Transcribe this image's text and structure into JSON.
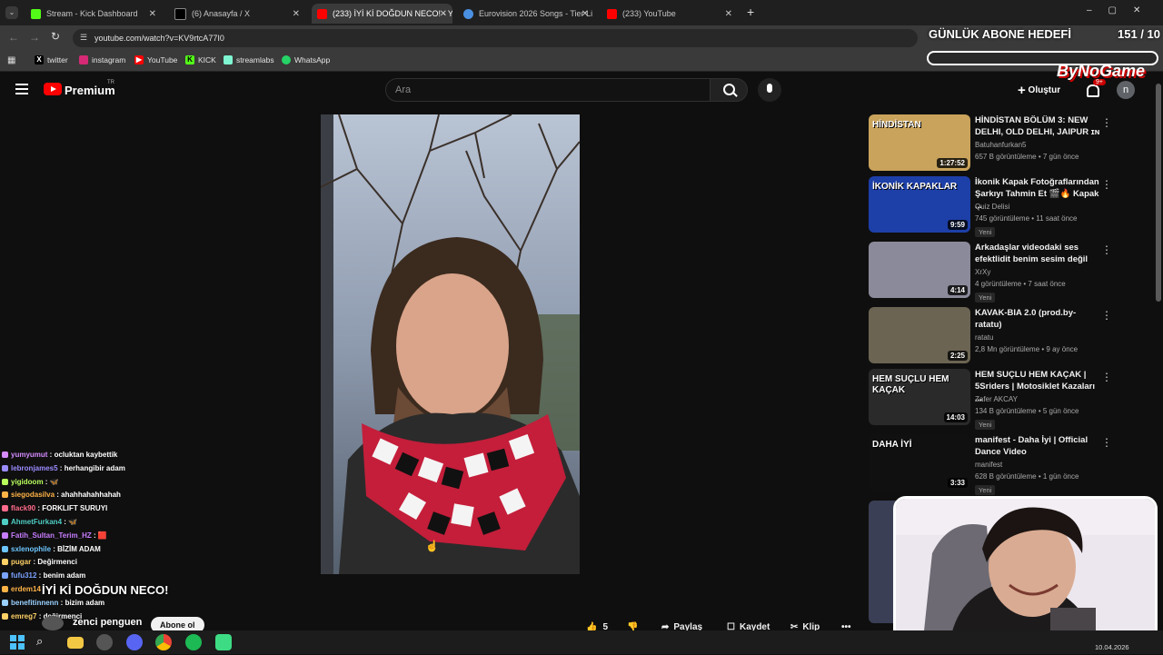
{
  "browser": {
    "tabs": [
      {
        "title": "Stream - Kick Dashboard",
        "color": "#53fc18"
      },
      {
        "title": "(6) Anasayfa / X",
        "color": "#ffffff"
      },
      {
        "title": "(233) İYİ Kİ DOĞDUN NECO! - Y",
        "color": "#ff0000"
      },
      {
        "title": "Eurovision 2026 Songs - Tier Li",
        "color": "#4a90e2"
      },
      {
        "title": "(233) YouTube",
        "color": "#ff0000"
      }
    ],
    "url": "youtube.com/watch?v=KV9rtcA77I0",
    "bookmarks": [
      "twitter",
      "instagram",
      "YouTube",
      "KICK",
      "streamlabs",
      "WhatsApp"
    ]
  },
  "youtube": {
    "logo": "Premium",
    "logo_sup": "TR",
    "search_placeholder": "Ara",
    "create_label": "Oluştur",
    "notif_count": "9+",
    "avatar_letter": "n",
    "actions": {
      "likes": "5",
      "share": "Paylaş",
      "save": "Kaydet",
      "clip": "Klip"
    },
    "channel_name": "zenci penguen",
    "subscribe": "Abone ol"
  },
  "suggestions": [
    {
      "title": "HİNDİSTAN BÖLÜM 3: NEW DELHI, OLD DELHI, JAIPUR ɪɴ",
      "channel": "Batuhanfurkan5",
      "meta": "657 B görüntüleme • 7 gün önce",
      "duration": "1:27:52",
      "badge": "",
      "thumb_text": "HİNDİSTAN",
      "color": "#c9a35b"
    },
    {
      "title": "İkonik Kapak Fotoğraflarından Şarkıyı Tahmin Et 🎬🔥 Kapak ...",
      "channel": "Quiz Delisi",
      "meta": "745 görüntüleme • 11 saat önce",
      "duration": "9:59",
      "badge": "Yeni",
      "thumb_text": "İKONİK KAPAKLAR",
      "color": "#1d3fa8"
    },
    {
      "title": "Arkadaşlar videodaki ses efektlidit benim sesim değil",
      "channel": "XrXy",
      "meta": "4 görüntüleme • 7 saat önce",
      "duration": "4:14",
      "badge": "Yeni",
      "thumb_text": "",
      "color": "#8a8a9a"
    },
    {
      "title": "KAVAK-BIA 2.0 (prod.by-ratatu)",
      "channel": "ratatu",
      "meta": "2,8 Mn görüntüleme • 9 ay önce",
      "duration": "2:25",
      "badge": "",
      "thumb_text": "",
      "color": "#6b6452"
    },
    {
      "title": "HEM SUÇLU HEM KAÇAK | 5Sriders | Motosiklet Kazaları ...",
      "channel": "Zafer AKCAY",
      "meta": "134 B görüntüleme • 5 gün önce",
      "duration": "14:03",
      "badge": "Yeni",
      "thumb_text": "HEM SUÇLU HEM KAÇAK",
      "color": "#2a2a2a"
    },
    {
      "title": "manifest - Daha İyi | Official Dance Video",
      "channel": "manifest",
      "meta": "628 B görüntüleme • 1 gün önce",
      "duration": "3:33",
      "badge": "Yeni",
      "thumb_text": "DAHA İYİ",
      "color": "#101010"
    }
  ],
  "chat": [
    {
      "user": "yumyumut",
      "msg": "ocluktan kaybettik",
      "color": "#d58bff"
    },
    {
      "user": "lebronjames5",
      "msg": "herhangibir adam",
      "color": "#9a8cff"
    },
    {
      "user": "yigidoom",
      "msg": "🦋",
      "color": "#b8ff5c"
    },
    {
      "user": "siegodasilva",
      "msg": "ahahhahahhahah",
      "color": "#ffb347"
    },
    {
      "user": "flack90",
      "msg": "FORKLIFT SURUYI",
      "color": "#ff6b8a"
    },
    {
      "user": "AhmetFurkan4",
      "msg": "🦋",
      "color": "#4ecdc4"
    },
    {
      "user": "Fatih_Sultan_Terim_HZ",
      "msg": "🟥",
      "color": "#c77dff"
    },
    {
      "user": "sxlenophile",
      "msg": "BİZİM ADAM",
      "color": "#6ec6ff"
    },
    {
      "user": "pugar",
      "msg": "Değirmenci",
      "color": "#ffd166"
    },
    {
      "user": "fufu312",
      "msg": "benim adam",
      "color": "#7aa2ff"
    },
    {
      "user": "erdem14",
      "msg": "İYİ Kİ DOĞDUN NECO!",
      "color": "#ffb347"
    },
    {
      "user": "benefitinnenn",
      "msg": "bizim adam",
      "color": "#9ad1ff"
    },
    {
      "user": "emreg7",
      "msg": "değirmenci",
      "color": "#ffd166"
    }
  ],
  "overlay": {
    "goal_label": "GÜNLÜK ABONE HEDEFİ",
    "goal_count": "151 / 10",
    "brand": "ByNoGame"
  },
  "taskbar": {
    "date": "10.04.2026"
  }
}
